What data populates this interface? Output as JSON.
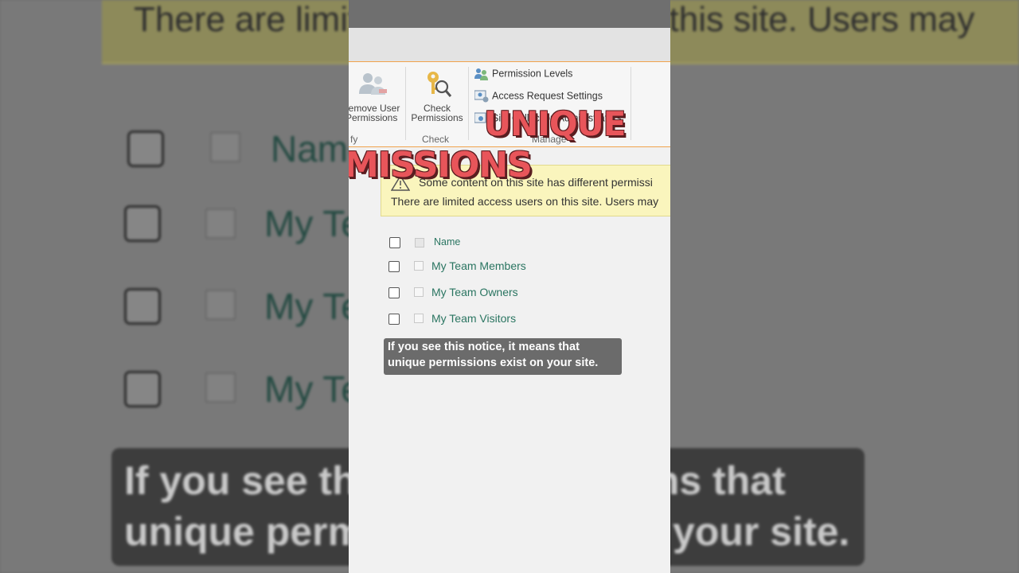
{
  "background": {
    "banner_text": "There are limited access users on this site. Users may",
    "header_name": "Name",
    "rows": [
      "My Te",
      "My Te",
      "My Te"
    ],
    "caption_lines": [
      "If you see this notice, it means that",
      "unique permissions exist on your site."
    ]
  },
  "ribbon": {
    "remove_user_label_line1": "emove User",
    "remove_user_label_line2": "Permissions",
    "modify_group_label": "fy",
    "check_permissions_line1": "Check",
    "check_permissions_line2": "Permissions",
    "check_group_label": "Check",
    "manage_items": [
      {
        "label": "Permission Levels",
        "icon": "permission-levels-icon"
      },
      {
        "label": "Access Request Settings",
        "icon": "access-request-settings-icon"
      },
      {
        "label": "Site Collection Administrators",
        "icon": "site-collection-admins-icon"
      }
    ],
    "manage_group_label": "Manage"
  },
  "overlay": {
    "word1": "UNIQUE",
    "word2": "MISSIONS"
  },
  "notice": {
    "line1": "Some content on this site has different permissi",
    "line2": "There are limited access users on this site. Users may"
  },
  "list": {
    "header": "Name",
    "items": [
      {
        "name": "My Team Members"
      },
      {
        "name": "My Team Owners"
      },
      {
        "name": "My Team Visitors"
      }
    ]
  },
  "caption": {
    "line1": "If you see this notice, it means that",
    "line2": "unique permissions exist on your site."
  },
  "colors": {
    "accent_orange": "#f0a24c",
    "link_green": "#2a7561",
    "notice_yellow": "#faf5bd",
    "overlay_red": "#e8555a"
  }
}
